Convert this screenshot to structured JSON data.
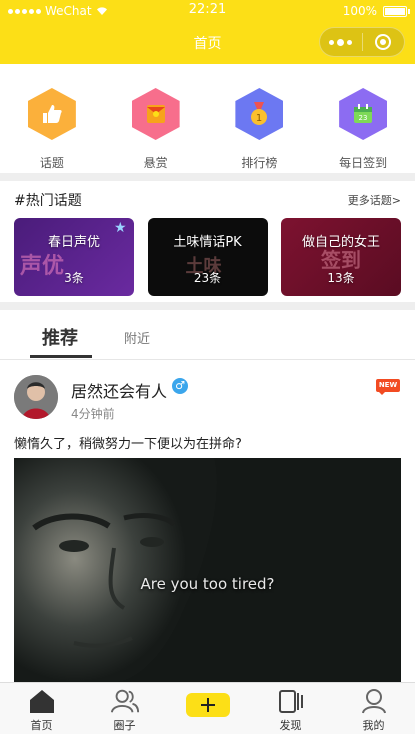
{
  "status_bar": {
    "carrier": "WeChat",
    "time": "22:21",
    "battery": "100%"
  },
  "nav": {
    "title": "首页"
  },
  "categories": [
    {
      "label": "话题",
      "icon": "thumbs-up-icon",
      "color": "#fbb03b"
    },
    {
      "label": "悬赏",
      "icon": "red-envelope-icon",
      "color": "#f76e8c"
    },
    {
      "label": "排行榜",
      "icon": "medal-icon",
      "color": "#6c78f2"
    },
    {
      "label": "每日签到",
      "icon": "calendar-icon",
      "color": "#8c6cf2"
    }
  ],
  "hot_topics": {
    "title": "#热门话题",
    "more": "更多话题>",
    "items": [
      {
        "name": "春日声优",
        "count": "3条"
      },
      {
        "name": "土味情话PK",
        "count": "23条"
      },
      {
        "name": "做自己的女王",
        "count": "13条"
      }
    ]
  },
  "tabs": {
    "recommend": "推荐",
    "nearby": "附近"
  },
  "post": {
    "username": "居然还会有人",
    "gender": "♂",
    "time": "4分钟前",
    "badge": "NEW",
    "text": "懒惰久了，稍微努力一下便以为在拼命?",
    "image_caption": "Are you too tired?"
  },
  "tabbar": [
    {
      "label": "首页",
      "icon": "home-icon"
    },
    {
      "label": "圈子",
      "icon": "users-icon"
    },
    {
      "label": "",
      "icon": "plus-icon"
    },
    {
      "label": "发现",
      "icon": "discover-icon"
    },
    {
      "label": "我的",
      "icon": "profile-icon"
    }
  ],
  "colors": {
    "brand": "#fcdf17"
  }
}
